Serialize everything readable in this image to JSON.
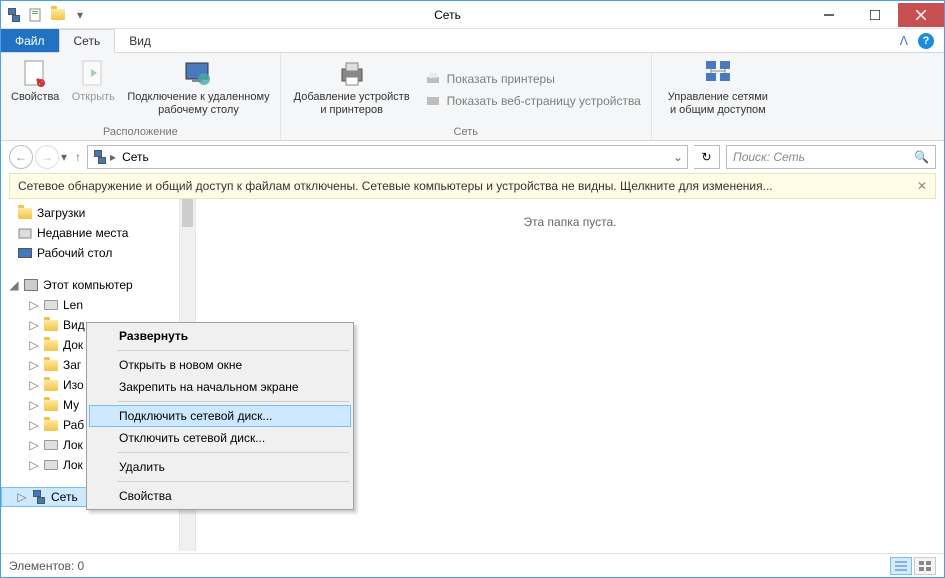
{
  "window": {
    "title": "Сеть"
  },
  "tabs": {
    "file": "Файл",
    "network": "Сеть",
    "view": "Вид"
  },
  "ribbon": {
    "group1": {
      "label": "Расположение",
      "properties": "Свойства",
      "open": "Открыть",
      "remote_desktop": "Подключение к удаленному\nрабочему столу"
    },
    "group2": {
      "label": "Сеть",
      "add_devices": "Добавление устройств\nи принтеров",
      "show_printers": "Показать принтеры",
      "show_device_page": "Показать веб-страницу устройства"
    },
    "group3": {
      "manage_networks": "Управление сетями\nи общим доступом"
    }
  },
  "address": {
    "crumb": "Сеть"
  },
  "search": {
    "placeholder": "Поиск: Сеть"
  },
  "infobar": {
    "text": "Сетевое обнаружение и общий доступ к файлам отключены. Сетевые компьютеры и устройства не видны. Щелкните для изменения..."
  },
  "tree": {
    "downloads": "Загрузки",
    "recent": "Недавние места",
    "desktop": "Рабочий стол",
    "this_pc": "Этот компьютер",
    "items": [
      "Len",
      "Вид",
      "Док",
      "Заг",
      "Изо",
      "Му",
      "Раб",
      "Лок",
      "Лок"
    ],
    "network": "Сеть"
  },
  "content": {
    "empty": "Эта папка пуста."
  },
  "context_menu": {
    "expand": "Развернуть",
    "open_new_window": "Открыть в новом окне",
    "pin_start": "Закрепить на начальном экране",
    "map_drive": "Подключить сетевой диск...",
    "disconnect_drive": "Отключить сетевой диск...",
    "delete": "Удалить",
    "properties": "Свойства"
  },
  "status": {
    "elements": "Элементов: 0"
  }
}
